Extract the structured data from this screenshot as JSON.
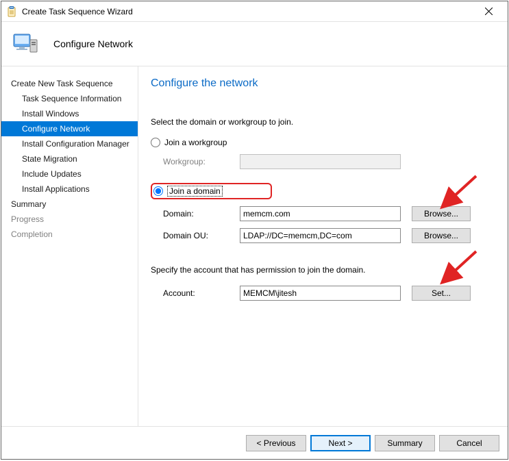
{
  "window": {
    "title": "Create Task Sequence Wizard"
  },
  "header": {
    "page_title": "Configure Network"
  },
  "sidebar": {
    "items": [
      {
        "label": "Create New Task Sequence",
        "sub": false,
        "active": false
      },
      {
        "label": "Task Sequence Information",
        "sub": true,
        "active": false
      },
      {
        "label": "Install Windows",
        "sub": true,
        "active": false
      },
      {
        "label": "Configure Network",
        "sub": true,
        "active": true
      },
      {
        "label": "Install Configuration Manager",
        "sub": true,
        "active": false
      },
      {
        "label": "State Migration",
        "sub": true,
        "active": false
      },
      {
        "label": "Include Updates",
        "sub": true,
        "active": false
      },
      {
        "label": "Install Applications",
        "sub": true,
        "active": false
      },
      {
        "label": "Summary",
        "sub": false,
        "active": false
      },
      {
        "label": "Progress",
        "sub": false,
        "active": false,
        "dim": true
      },
      {
        "label": "Completion",
        "sub": false,
        "active": false,
        "dim": true
      }
    ]
  },
  "content": {
    "heading": "Configure the network",
    "instruction": "Select the domain or workgroup to join.",
    "radio_workgroup": "Join a workgroup",
    "workgroup_label": "Workgroup:",
    "workgroup_value": "",
    "radio_domain": "Join a domain",
    "domain_label": "Domain:",
    "domain_value": "memcm.com",
    "domain_ou_label": "Domain OU:",
    "domain_ou_value": "LDAP://DC=memcm,DC=com",
    "browse1": "Browse...",
    "browse2": "Browse...",
    "account_instruction": "Specify the account that has permission to join the domain.",
    "account_label": "Account:",
    "account_value": "MEMCM\\jitesh",
    "set_btn": "Set..."
  },
  "footer": {
    "previous": "< Previous",
    "next": "Next >",
    "summary": "Summary",
    "cancel": "Cancel"
  }
}
